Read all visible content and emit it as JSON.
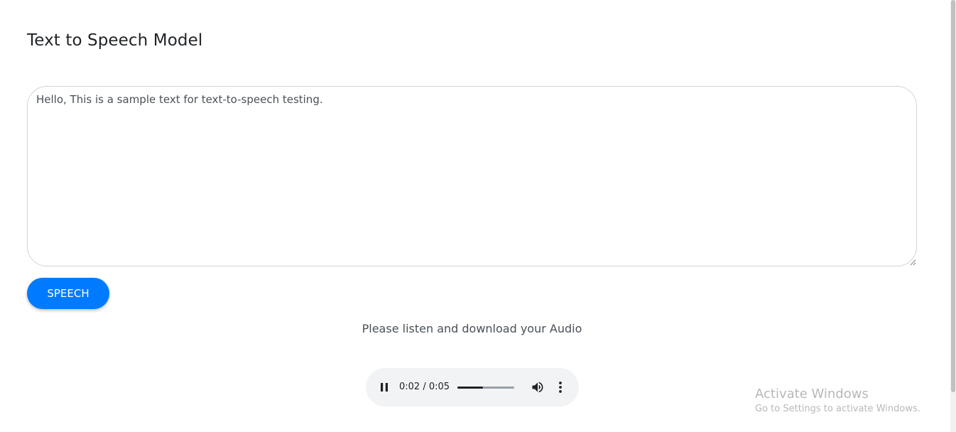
{
  "page": {
    "title": "Text to Speech Model"
  },
  "input": {
    "value": "Hello, This is a sample text for text-to-speech testing."
  },
  "speech_button": {
    "label": "SPEECH"
  },
  "result": {
    "message": "Please listen and download your Audio"
  },
  "audio": {
    "time_display": "0:02 / 0:05",
    "progress": 0.45,
    "state": "playing"
  },
  "watermark": {
    "title": "Activate Windows",
    "subtitle": "Go to Settings to activate Windows."
  },
  "colors": {
    "accent": "#007bff",
    "player_bg": "#f1f3f4"
  }
}
